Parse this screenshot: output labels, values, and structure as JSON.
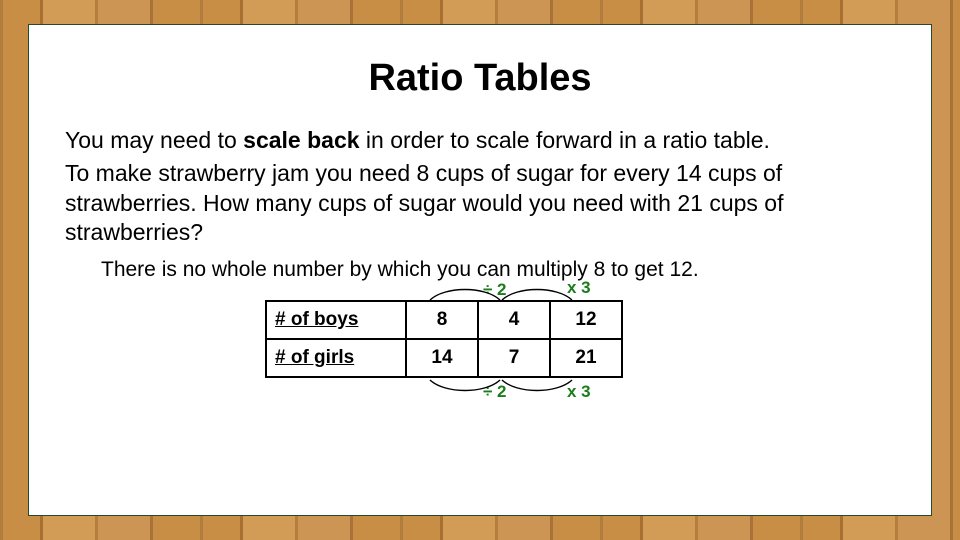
{
  "title": "Ratio Tables",
  "intro": {
    "pre": "You may need to ",
    "bold": "scale back",
    "post": " in order to scale forward in a ratio table."
  },
  "problem": "To make strawberry jam you need 8 cups of sugar for every 14 cups of strawberries.  How many cups of sugar would you need with 21 cups of strawberries?",
  "hint": "There is no whole number by which you can multiply 8 to get 12.",
  "table": {
    "row1_label": "# of boys",
    "row2_label": "# of girls",
    "r1c1": "8",
    "r1c2": "4",
    "r1c3": "12",
    "r2c1": "14",
    "r2c2": "7",
    "r2c3": "21"
  },
  "ops": {
    "div_top": "÷ 2",
    "mul_top": "x 3",
    "div_bot": "÷ 2",
    "mul_bot": "x 3"
  }
}
